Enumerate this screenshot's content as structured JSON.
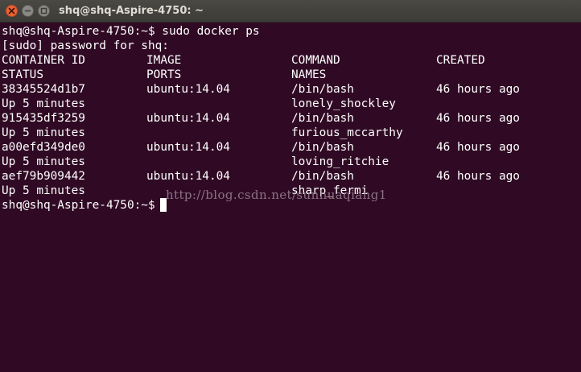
{
  "window": {
    "title": "shq@shq-Aspire-4750: ~",
    "close_glyph": "×",
    "minimize_glyph": "–",
    "maximize_glyph": "□"
  },
  "terminal": {
    "prompt": "shq@shq-Aspire-4750:~$ ",
    "command": "sudo docker ps",
    "sudo_prompt": "[sudo] password for shq:",
    "headers_line1": [
      "CONTAINER ID",
      "IMAGE",
      "COMMAND",
      "CREATED"
    ],
    "headers_line2": [
      "STATUS",
      "PORTS",
      "NAMES",
      ""
    ],
    "containers": [
      {
        "id": "38345524d1b7",
        "image": "ubuntu:14.04",
        "command": "/bin/bash",
        "created": "46 hours ago",
        "status": "Up 5 minutes",
        "ports": "",
        "names": "lonely_shockley"
      },
      {
        "id": "915435df3259",
        "image": "ubuntu:14.04",
        "command": "/bin/bash",
        "created": "46 hours ago",
        "status": "Up 5 minutes",
        "ports": "",
        "names": "furious_mccarthy"
      },
      {
        "id": "a00efd349de0",
        "image": "ubuntu:14.04",
        "command": "/bin/bash",
        "created": "46 hours ago",
        "status": "Up 5 minutes",
        "ports": "",
        "names": "loving_ritchie"
      },
      {
        "id": "aef79b909442",
        "image": "ubuntu:14.04",
        "command": "/bin/bash",
        "created": "46 hours ago",
        "status": "Up 5 minutes",
        "ports": "",
        "names": "sharp_fermi"
      }
    ],
    "final_prompt": "shq@shq-Aspire-4750:~$"
  },
  "watermark": "http://blog.csdn.net/sunhuaqiang1",
  "colors": {
    "terminal_bg": "#300a24",
    "terminal_fg": "#ffffff",
    "titlebar_bg": "#3c3b37",
    "close_button": "#ea6234"
  }
}
